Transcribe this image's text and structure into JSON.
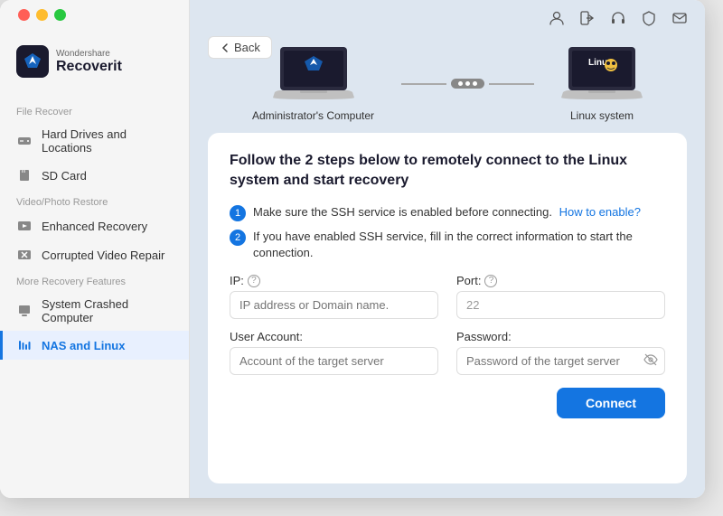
{
  "window": {
    "title": "Wondershare Recoverit"
  },
  "sidebar": {
    "logo_brand": "Wondershare",
    "logo_app": "Recoverit",
    "sections": [
      {
        "label": "File Recover",
        "items": [
          {
            "id": "hard-drives",
            "label": "Hard Drives and Locations",
            "active": false,
            "icon": "hdd"
          },
          {
            "id": "sd-card",
            "label": "SD Card",
            "active": false,
            "icon": "sdcard"
          }
        ]
      },
      {
        "label": "Video/Photo Restore",
        "items": [
          {
            "id": "enhanced-recovery",
            "label": "Enhanced Recovery",
            "active": false,
            "icon": "video"
          },
          {
            "id": "corrupted-video",
            "label": "Corrupted Video Repair",
            "active": false,
            "icon": "wrench"
          }
        ]
      },
      {
        "label": "More Recovery Features",
        "items": [
          {
            "id": "system-crashed",
            "label": "System Crashed Computer",
            "active": false,
            "icon": "computer"
          },
          {
            "id": "nas-linux",
            "label": "NAS and Linux",
            "active": true,
            "icon": "bars"
          }
        ]
      }
    ]
  },
  "back_button": "Back",
  "diagram": {
    "admin_label": "Administrator's Computer",
    "linux_label": "Linux system"
  },
  "form": {
    "title": "Follow the 2 steps below to remotely connect to the Linux system and start recovery",
    "steps": [
      {
        "num": "1",
        "text": "Make sure the SSH service is enabled before connecting.",
        "link_text": "How to enable?",
        "link": "#"
      },
      {
        "num": "2",
        "text": "If you have enabled SSH service, fill in the correct information to start the connection.",
        "link_text": "",
        "link": ""
      }
    ],
    "fields": {
      "ip_label": "IP:",
      "ip_placeholder": "IP address or Domain name.",
      "port_label": "Port:",
      "port_value": "22",
      "user_label": "User Account:",
      "user_placeholder": "Account of the target server",
      "password_label": "Password:",
      "password_placeholder": "Password of the target server"
    },
    "connect_btn": "Connect"
  },
  "topbar_icons": [
    "user",
    "signin",
    "headphone",
    "shield",
    "mail"
  ]
}
